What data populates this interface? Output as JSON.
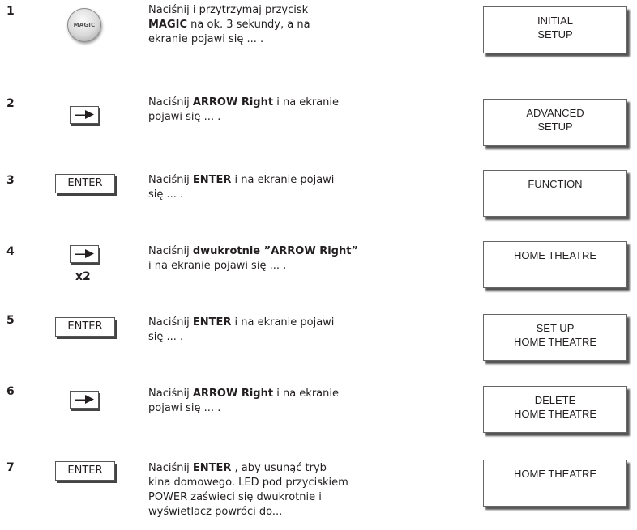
{
  "steps": [
    {
      "number": "1",
      "icon": "magic-button",
      "icon_label": "MAGIC",
      "text_before": "Naciśnij i przytrzymaj przycisk ",
      "text_bold": "MAGIC",
      "text_after": " na ok. 3 sekundy, a na ekranie pojawi się ... .",
      "screen_line1": "INITIAL",
      "screen_line2": "SETUP"
    },
    {
      "number": "2",
      "icon": "arrow-right-key",
      "text_before": "Naciśnij ",
      "text_bold": "ARROW Right",
      "text_after": " i na ekranie pojawi się ... .",
      "screen_line1": "ADVANCED",
      "screen_line2": "SETUP"
    },
    {
      "number": "3",
      "icon": "enter-key",
      "icon_label": "ENTER",
      "text_before": "Naciśnij ",
      "text_bold": "ENTER",
      "text_after": " i na ekranie pojawi się ... .",
      "screen_line1": "FUNCTION",
      "screen_line2": ""
    },
    {
      "number": "4",
      "icon": "arrow-right-key",
      "multiplier": "x2",
      "text_before": "Naciśnij ",
      "text_bold": "dwukrotnie ”ARROW Right”",
      "text_after": " i na ekranie pojawi się ... .",
      "screen_line1": "HOME THEATRE",
      "screen_line2": ""
    },
    {
      "number": "5",
      "icon": "enter-key",
      "icon_label": "ENTER",
      "text_before": "Naciśnij ",
      "text_bold": "ENTER",
      "text_after": " i na ekranie pojawi się ... .",
      "screen_line1": "SET UP",
      "screen_line2": "HOME THEATRE"
    },
    {
      "number": "6",
      "icon": "arrow-right-key",
      "text_before": "Naciśnij ",
      "text_bold": "ARROW Right",
      "text_after": " i na ekranie pojawi się ... .",
      "screen_line1": "DELETE",
      "screen_line2": "HOME THEATRE"
    },
    {
      "number": "7",
      "icon": "enter-key",
      "icon_label": "ENTER",
      "text_before": "Naciśnij ",
      "text_bold": "ENTER",
      "text_after": " , aby usunąć tryb kina domowego. LED pod przyciskiem POWER zaświeci się dwukrotnie i wyświetlacz powróci do...",
      "screen_line1": "HOME THEATRE",
      "screen_line2": ""
    }
  ]
}
